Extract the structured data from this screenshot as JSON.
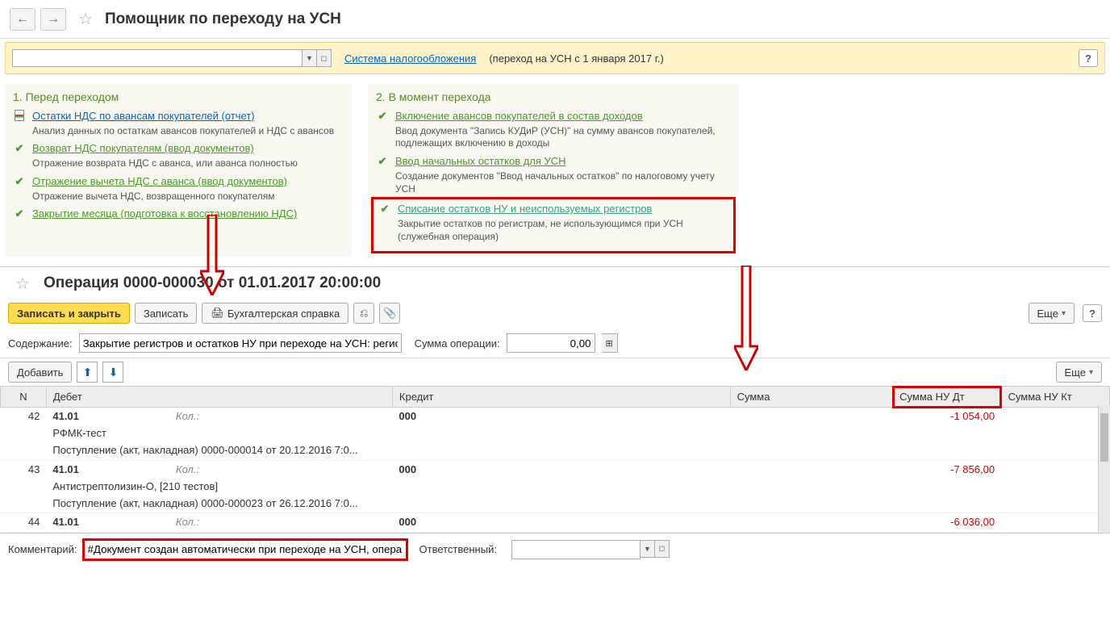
{
  "header": {
    "title": "Помощник по переходу на УСН"
  },
  "infoBar": {
    "link": "Система налогообложения",
    "text": "(переход на УСН с 1 января 2017 г.)"
  },
  "steps": {
    "left": {
      "title": "1. Перед переходом",
      "items": [
        {
          "icon": "report",
          "link_class": "",
          "link": "Остатки НДС по авансам покупателей (отчет)",
          "desc": "Анализ данных по остаткам авансов покупателей и НДС с авансов"
        },
        {
          "icon": "check",
          "link_class": "green",
          "link": "Возврат НДС покупателям (ввод документов)",
          "desc": "Отражение возврата НДС с аванса, или аванса полностью"
        },
        {
          "icon": "check",
          "link_class": "green",
          "link": "Отражение вычета НДС с аванса (ввод документов)",
          "desc": "Отражение вычета НДС, возвращенного покупателям"
        },
        {
          "icon": "check",
          "link_class": "green",
          "link": "Закрытие месяца (подготовка к восстановлению НДС)",
          "desc": ""
        }
      ]
    },
    "right": {
      "title": "2. В момент перехода",
      "items": [
        {
          "icon": "check",
          "link_class": "green",
          "link": "Включение авансов покупателей в состав доходов",
          "desc": "Ввод документа \"Запись КУДиР (УСН)\" на сумму авансов покупателей, подлежащих включению в доходы",
          "highlight": false
        },
        {
          "icon": "check",
          "link_class": "green",
          "link": "Ввод начальных остатков для УСН",
          "desc": "Создание документов \"Ввод начальных остатков\" по налоговому учету УСН",
          "highlight": false
        },
        {
          "icon": "check",
          "link_class": "bluegreen",
          "link": "Списание остатков НУ и неиспользуемых регистров",
          "desc": "Закрытие остатков по регистрам, не использующимся при УСН (служебная операция)",
          "highlight": true
        }
      ]
    }
  },
  "operation": {
    "title": "Операция 0000-000030 от 01.01.2017 20:00:00",
    "toolbar": {
      "save_close": "Записать и закрыть",
      "save": "Записать",
      "print_ref": "Бухгалтерская справка",
      "more": "Еще"
    },
    "form": {
      "content_label": "Содержание:",
      "content_value": "Закрытие регистров и остатков НУ при переходе на УСН: регистр б",
      "sum_label": "Сумма операции:",
      "sum_value": "0,00"
    },
    "table_toolbar": {
      "add": "Добавить",
      "more": "Еще"
    },
    "columns": {
      "n": "N",
      "debit": "Дебет",
      "credit": "Кредит",
      "sum": "Сумма",
      "sum_nu_dt": "Сумма НУ Дт",
      "sum_nu_kt": "Сумма НУ Кт"
    },
    "kol_label": "Кол.:",
    "rows": [
      {
        "n": "42",
        "acc_dt": "41.01",
        "acc_kt": "000",
        "sub1": "РФМК-тест",
        "sub2": "Поступление (акт, накладная) 0000-000014 от 20.12.2016 7:0...",
        "sum_nu_dt": "-1 054,00"
      },
      {
        "n": "43",
        "acc_dt": "41.01",
        "acc_kt": "000",
        "sub1": "Антистрептолизин-О, [210 тестов]",
        "sub2": "Поступление (акт, накладная) 0000-000023 от 26.12.2016 7:0...",
        "sum_nu_dt": "-7 856,00"
      },
      {
        "n": "44",
        "acc_dt": "41.01",
        "acc_kt": "000",
        "sub1": "",
        "sub2": "",
        "sum_nu_dt": "-6 036,00"
      }
    ],
    "footer": {
      "comment_label": "Комментарий:",
      "comment_value": "#Документ создан автоматически при переходе на УСН, операция",
      "resp_label": "Ответственный:"
    }
  }
}
